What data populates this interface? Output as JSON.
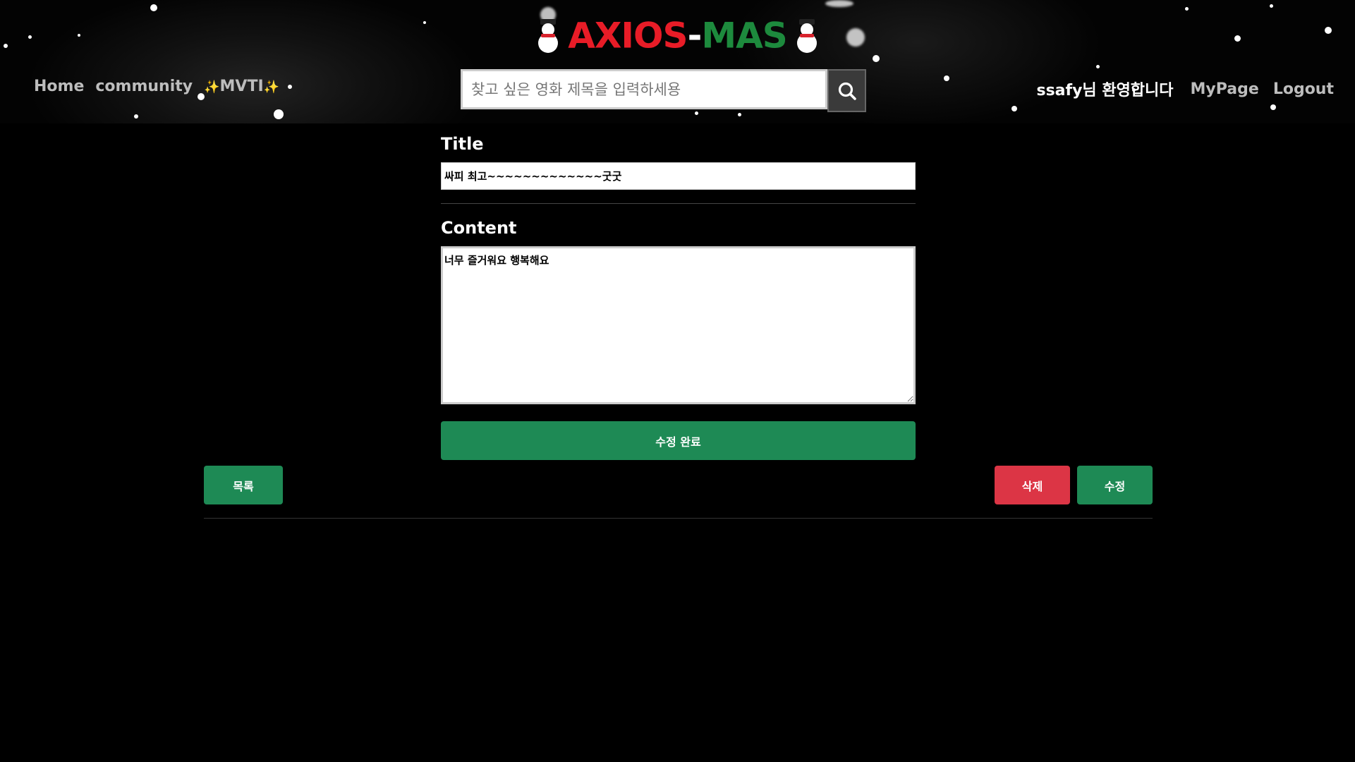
{
  "header": {
    "logo_part1": "AXIOS",
    "logo_dash": "-",
    "logo_part2": "MAS",
    "logo_icon": "snowman-icon",
    "nav": {
      "home": "Home",
      "community": "community",
      "mvti": "MVTI",
      "sparkle": "✨"
    },
    "search": {
      "placeholder": "찾고 싶은 영화 제목을 입력하세용",
      "icon": "search-icon"
    },
    "welcome": "ssafy님 환영합니다",
    "mypage": "MyPage",
    "logout": "Logout"
  },
  "form": {
    "title_label": "Title",
    "title_value": "싸피 최고~~~~~~~~~~~~~굿굿",
    "content_label": "Content",
    "content_value": "너무 즐거워요 행복해요",
    "submit_label": "수정 완료"
  },
  "actions": {
    "list_label": "목록",
    "delete_label": "삭제",
    "edit_label": "수정"
  },
  "colors": {
    "logo_red": "#e81c27",
    "logo_green": "#1d8a3d",
    "button_green": "#1e8a55",
    "button_red": "#dc3545",
    "background": "#000000"
  }
}
